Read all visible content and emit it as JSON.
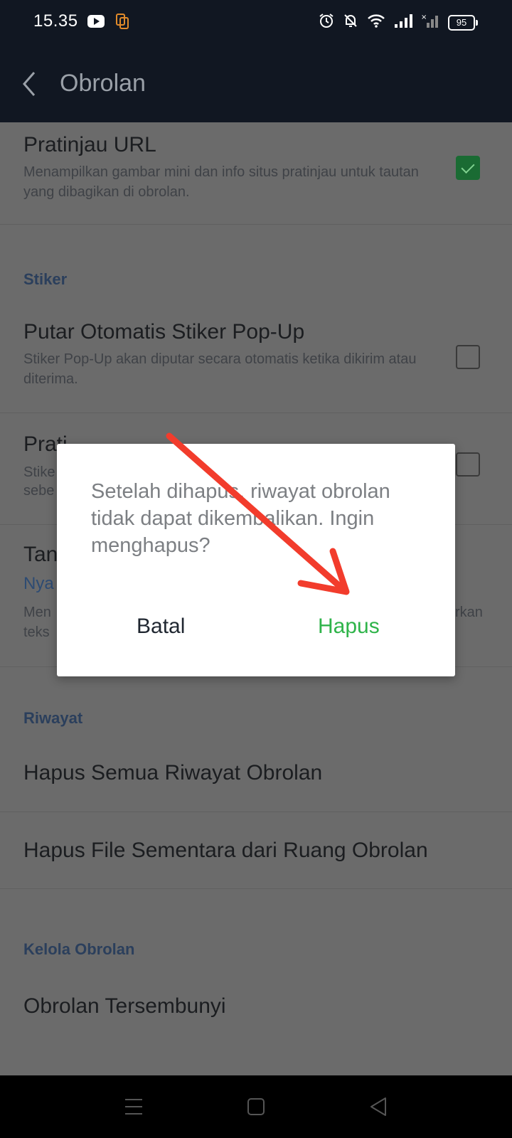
{
  "status_bar": {
    "time": "15.35",
    "battery": "95",
    "icons": [
      "youtube-icon",
      "screen-mirror-icon",
      "alarm-icon",
      "mute-icon",
      "wifi-icon",
      "signal-icon",
      "signal-icon-2"
    ]
  },
  "app_bar": {
    "title": "Obrolan"
  },
  "settings": {
    "url_preview": {
      "title": "Pratinjau URL",
      "desc": "Menampilkan gambar mini dan info situs pratinjau untuk tautan yang dibagikan di obrolan.",
      "checked": true
    },
    "section_sticker": "Stiker",
    "sticker_autoplay": {
      "title": "Putar Otomatis Stiker Pop-Up",
      "desc": "Stiker Pop-Up akan diputar secara otomatis ketika dikirim atau diterima.",
      "checked": false
    },
    "sticker_preview": {
      "title": "Prati",
      "desc_line1": "Stike",
      "desc_line2": "sebe",
      "checked": false
    },
    "partial_row": {
      "title": "Tan",
      "value": "Nya",
      "desc_line1": "Men",
      "desc_line2": "teks",
      "desc_right": "rkan"
    },
    "section_history": "Riwayat",
    "delete_all_history": "Hapus Semua Riwayat Obrolan",
    "delete_temp_files": "Hapus File Sementara dari Ruang Obrolan",
    "section_manage": "Kelola Obrolan",
    "hidden_chats": "Obrolan Tersembunyi"
  },
  "dialog": {
    "message": "Setelah dihapus, riwayat obrolan tidak dapat dikembalikan. Ingin menghapus?",
    "cancel_label": "Batal",
    "confirm_label": "Hapus"
  },
  "colors": {
    "accent_green": "#2fb44a",
    "annotation_red": "#f23c2c",
    "app_bar": "#111722",
    "scrim": "#6b6b6b"
  }
}
